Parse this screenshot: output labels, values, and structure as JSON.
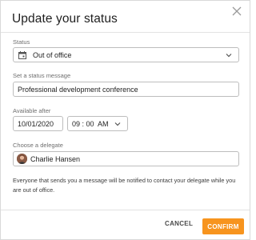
{
  "dialog": {
    "title": "Update your status",
    "close_icon": "close-icon"
  },
  "status": {
    "label": "Status",
    "value": "Out of office",
    "icon": "calendar-icon"
  },
  "message": {
    "label": "Set a status message",
    "value": "Professional development conference"
  },
  "available": {
    "label": "Available after",
    "date": "10/01/2020",
    "time": "09 : 00  AM"
  },
  "delegate": {
    "label": "Choose a delegate",
    "name": "Charlie Hansen"
  },
  "note": "Everyone that sends you a message will be notified to contact your delegate while you are out of office.",
  "actions": {
    "cancel": "CANCEL",
    "confirm": "CONFIRM"
  },
  "colors": {
    "accent": "#f7941e"
  }
}
